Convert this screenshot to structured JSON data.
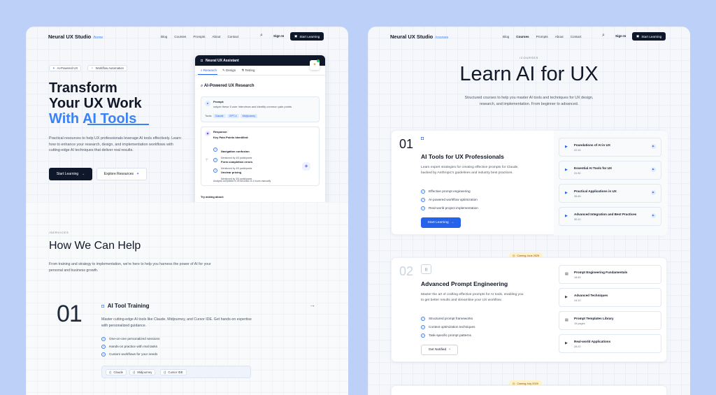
{
  "left": {
    "nav": {
      "logo": "Neural UX Studio",
      "logo_sub": "/home",
      "links": [
        "Blog",
        "Courses",
        "Prompts",
        "About",
        "Contact"
      ],
      "signin": "Sign In",
      "start": "Start Learning"
    },
    "pills": [
      "AI-Powered UX",
      "Workflow Automation"
    ],
    "hero": {
      "line1": "Transform",
      "line2": "Your UX Work",
      "line3": "With AI Tools",
      "desc": "Practical resources to help UX professionals leverage AI tools effectively. Learn how to enhance your research, design, and implementation workflows with cutting-edge AI techniques that deliver real results.",
      "btn_primary": "Start Learning",
      "btn_secondary": "Explore Resources"
    },
    "assistant": {
      "title": "Neural UX Assistant",
      "tabs": [
        "Research",
        "Design",
        "Testing"
      ],
      "heading": "AI-Powered UX Research",
      "prompt_label": "Prompt:",
      "prompt_text": "nalyze these 5 user interviews and identify common pain points",
      "tools_label": "Tools:",
      "tools": [
        "Claude",
        "GPT-4",
        "Midjourney"
      ],
      "response_label": "Response:",
      "kp_label": "Key Pain Points Identified:",
      "points": [
        {
          "title": "Navigation confusion",
          "sub": "Mentioned by 4/5 participants"
        },
        {
          "title": "Form completion errors",
          "sub": "Mentioned by 4/5 participants"
        },
        {
          "title": "Unclear pricing",
          "sub": "Mentioned by 3/5 participants"
        }
      ],
      "footnote": "Analysis completed in 45 seconds vs 4 hours manually",
      "try": "Try asking about:"
    },
    "services": {
      "eyebrow": "/SERVICES",
      "title": "How We Can Help",
      "desc": "From training and strategy to implementation, we're here to help you harness the power of AI for your personal and business growth.",
      "card": {
        "num": "01",
        "title": "AI Tool Training",
        "desc": "Master cutting-edge AI tools like Claude, Midjourney, and Cursor IDE. Get hands-on expertise with personalized guidance.",
        "features": [
          "One-on-one personalized sessions",
          "Hands-on practice with real tasks",
          "Custom workflows for your needs"
        ],
        "tools": [
          "Claude",
          "Midjourney",
          "Cursor IDE"
        ]
      }
    }
  },
  "right": {
    "nav": {
      "logo": "Neural UX Studio",
      "logo_sub": "/courses",
      "links": [
        "Blog",
        "Courses",
        "Prompts",
        "About",
        "Contact"
      ],
      "signin": "Sign In",
      "start": "Start Learning"
    },
    "eyebrow": "/COURSES",
    "title": "Learn AI for UX",
    "desc1": "Structured courses to help you master AI tools and techniques for UX design,",
    "desc2": "research, and implementation. From beginner to advanced.",
    "course1": {
      "num": "01",
      "title": "AI Tools for UX Professionals",
      "desc": "Learn expert strategies for creating effective prompts for Claude, backed by Anthropic's guidelines and industry best practices.",
      "features": [
        "Effective prompt engineering",
        "AI-powered workflow optimization",
        "Real-world project implementation"
      ],
      "btn": "Start Learning",
      "lessons": [
        {
          "title": "Foundations of AI in UX",
          "dur": "22:15"
        },
        {
          "title": "Essential AI Tools for UX",
          "dur": "31:30"
        },
        {
          "title": "Practical Applications in UX",
          "dur": "35:45"
        },
        {
          "title": "Advanced Integration and Best Practices",
          "dur": "30:10"
        }
      ]
    },
    "badge1": "Coming June 2025",
    "course2": {
      "num": "02",
      "title": "Advanced Prompt Engineering",
      "desc": "Master the art of crafting effective prompts for AI tools, enabling you to get better results and streamline your UX workflow.",
      "features": [
        "Structured prompt frameworks",
        "Context optimization techniques",
        "Task-specific prompt patterns"
      ],
      "btn": "Get Notified",
      "lessons": [
        {
          "title": "Prompt Engineering Fundamentals",
          "dur": "18:45"
        },
        {
          "title": "Advanced Techniques",
          "dur": "24:10"
        },
        {
          "title": "Prompt Templates Library",
          "dur": "15 pages"
        },
        {
          "title": "Real-world Applications",
          "dur": "28:20"
        }
      ]
    },
    "badge2": "Coming July 2025"
  }
}
